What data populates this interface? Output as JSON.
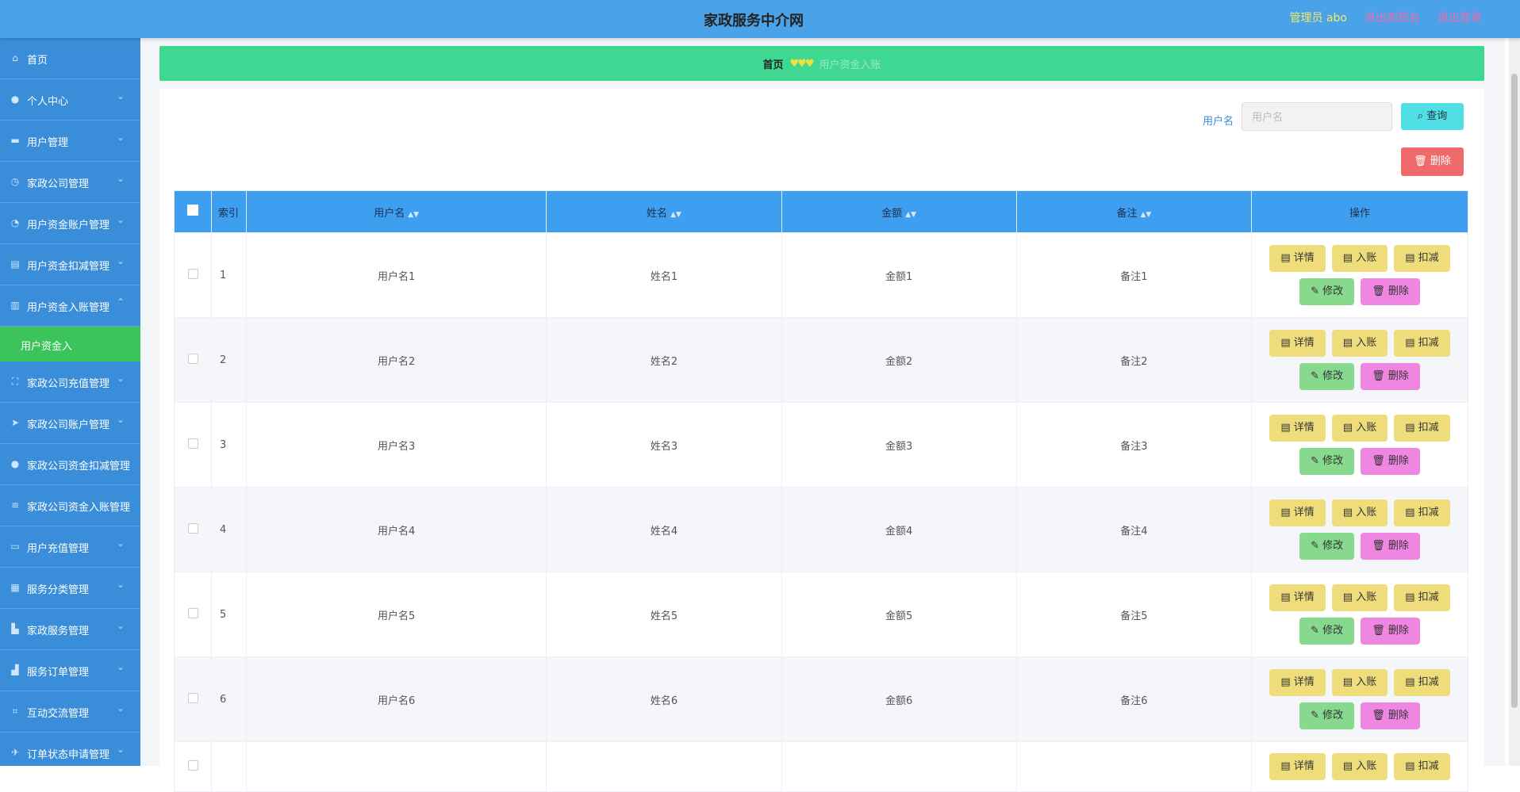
{
  "header": {
    "title": "家政服务中介网",
    "admin": "管理员 abo",
    "back_front": "退出到前台",
    "logout": "退出登录"
  },
  "sidebar": {
    "items": [
      {
        "label": "首页",
        "icon": "home-icon",
        "glyph": "⌂",
        "arrow": ""
      },
      {
        "label": "个人中心",
        "icon": "user-icon",
        "glyph": "●",
        "arrow": "⌄"
      },
      {
        "label": "用户管理",
        "icon": "message-icon",
        "glyph": "▬",
        "arrow": "⌄"
      },
      {
        "label": "家政公司管理",
        "icon": "clock-icon",
        "glyph": "◷",
        "arrow": "⌄"
      },
      {
        "label": "用户资金账户管理",
        "icon": "gauge-icon",
        "glyph": "◔",
        "arrow": "⌄"
      },
      {
        "label": "用户资金扣减管理",
        "icon": "chart-icon",
        "glyph": "▤",
        "arrow": "⌄"
      },
      {
        "label": "用户资金入账管理",
        "icon": "clipboard-icon",
        "glyph": "▥",
        "arrow": "⌃"
      },
      {
        "label": "家政公司充值管理",
        "icon": "frame-icon",
        "glyph": "⛶",
        "arrow": "⌄"
      },
      {
        "label": "家政公司账户管理",
        "icon": "send-icon",
        "glyph": "➤",
        "arrow": "⌄"
      },
      {
        "label": "家政公司资金扣减管理",
        "icon": "person-icon",
        "glyph": "●",
        "arrow": ""
      },
      {
        "label": "家政公司资金入账管理",
        "icon": "list-icon",
        "glyph": "≡",
        "arrow": ""
      },
      {
        "label": "用户充值管理",
        "icon": "chat-icon",
        "glyph": "▭",
        "arrow": "⌄"
      },
      {
        "label": "服务分类管理",
        "icon": "grid-icon",
        "glyph": "▦",
        "arrow": "⌄"
      },
      {
        "label": "家政服务管理",
        "icon": "building-icon",
        "glyph": "▙",
        "arrow": "⌄"
      },
      {
        "label": "服务订单管理",
        "icon": "bar-chart-icon",
        "glyph": "▟",
        "arrow": "⌄"
      },
      {
        "label": "互动交流管理",
        "icon": "crop-icon",
        "glyph": "⌗",
        "arrow": "⌄"
      },
      {
        "label": "订单状态申请管理",
        "icon": "plane-icon",
        "glyph": "✈",
        "arrow": "⌄"
      }
    ],
    "active_sub": "用户资金入"
  },
  "breadcrumb": {
    "home": "首页",
    "separator": "♥♥♥",
    "current": "用户资金入账"
  },
  "search": {
    "label": "用户名",
    "placeholder": "用户名",
    "query_button": "查询",
    "delete_button": "删除"
  },
  "table": {
    "headers": {
      "index": "索引",
      "username": "用户名",
      "name": "姓名",
      "amount": "金额",
      "remark": "备注",
      "ops": "操作"
    },
    "actions": {
      "detail": "详情",
      "deposit": "入账",
      "deduct": "扣减",
      "edit": "修改",
      "delete": "删除"
    },
    "rows": [
      {
        "index": "1",
        "username": "用户名1",
        "name": "姓名1",
        "amount": "金额1",
        "remark": "备注1"
      },
      {
        "index": "2",
        "username": "用户名2",
        "name": "姓名2",
        "amount": "金额2",
        "remark": "备注2"
      },
      {
        "index": "3",
        "username": "用户名3",
        "name": "姓名3",
        "amount": "金额3",
        "remark": "备注3"
      },
      {
        "index": "4",
        "username": "用户名4",
        "name": "姓名4",
        "amount": "金额4",
        "remark": "备注4"
      },
      {
        "index": "5",
        "username": "用户名5",
        "name": "姓名5",
        "amount": "金额5",
        "remark": "备注5"
      },
      {
        "index": "6",
        "username": "用户名6",
        "name": "姓名6",
        "amount": "金额6",
        "remark": "备注6"
      },
      {
        "index": "",
        "username": "",
        "name": "",
        "amount": "",
        "remark": ""
      }
    ]
  },
  "colors": {
    "header_bg": "#4aa3e8",
    "sidebar_bg": "#3a8ed9",
    "active_green": "#3cc45c",
    "breadcrumb_bg": "#3ed893",
    "table_head": "#3e9ef0"
  }
}
